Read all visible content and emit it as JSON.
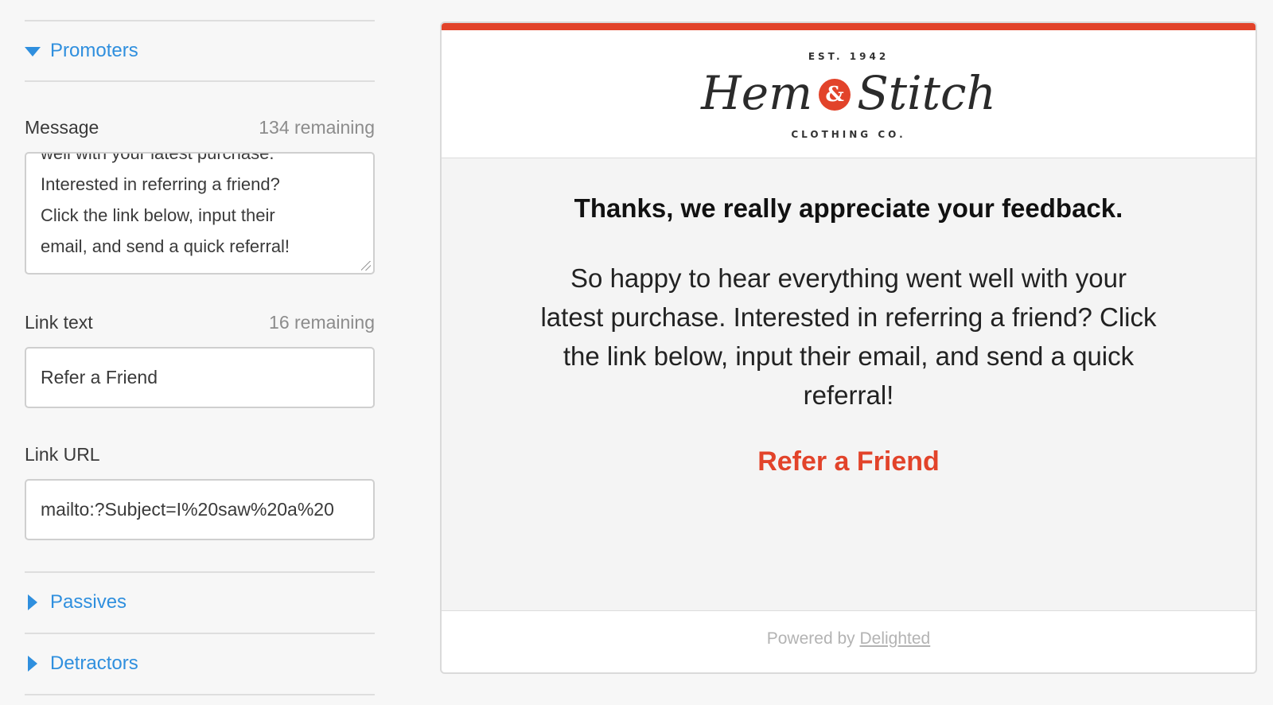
{
  "sections": {
    "promoters_label": "Promoters",
    "passives_label": "Passives",
    "detractors_label": "Detractors"
  },
  "message": {
    "label": "Message",
    "remaining": "134 remaining",
    "value": "well with your latest purchase.\nInterested in referring a friend?\nClick the link below, input their\nemail, and send a quick referral!"
  },
  "link_text": {
    "label": "Link text",
    "remaining": "16 remaining",
    "value": "Refer a Friend"
  },
  "link_url": {
    "label": "Link URL",
    "value": "mailto:?Subject=I%20saw%20a%20"
  },
  "preview": {
    "logo_est": "EST. 1942",
    "logo_word1": "Hem",
    "logo_amp": "&",
    "logo_word2": "Stitch",
    "logo_sub": "CLOTHING CO.",
    "heading": "Thanks, we really appreciate your feedback.",
    "body": "So happy to hear everything went well with your latest purchase. Interested in referring a friend? Click the link below, input their email, and send a quick referral!",
    "cta": "Refer a Friend",
    "powered_prefix": "Powered by",
    "powered_link": "Delighted"
  },
  "colors": {
    "accent": "#e2432a",
    "link_blue": "#2f8fde"
  }
}
